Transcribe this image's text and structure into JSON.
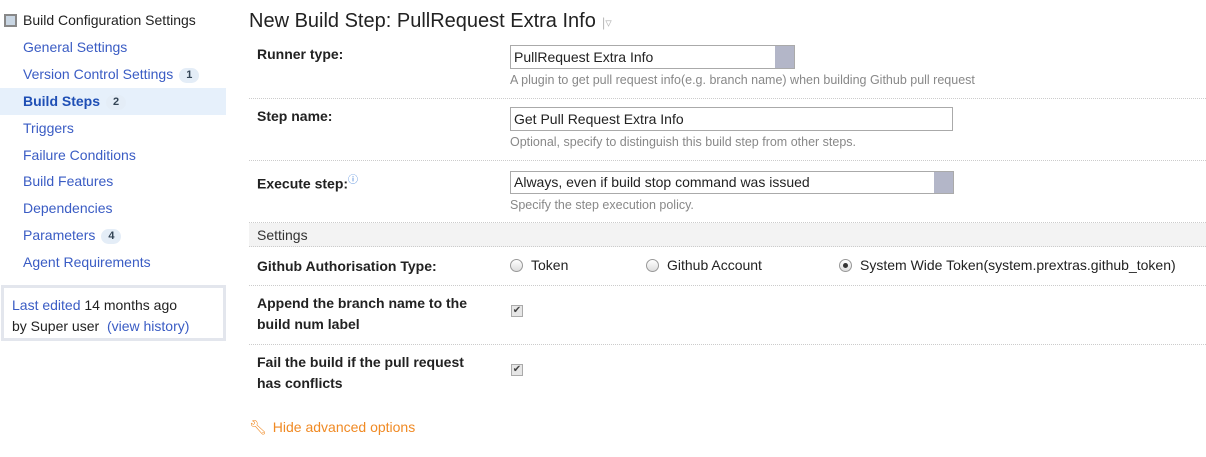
{
  "sidebar": {
    "header": "Build Configuration Settings",
    "items": [
      {
        "label": "General Settings"
      },
      {
        "label": "Version Control Settings",
        "badge": "1"
      },
      {
        "label": "Build Steps",
        "badge": "2"
      },
      {
        "label": "Triggers"
      },
      {
        "label": "Failure Conditions"
      },
      {
        "label": "Build Features"
      },
      {
        "label": "Dependencies"
      },
      {
        "label": "Parameters",
        "badge": "4"
      },
      {
        "label": "Agent Requirements"
      }
    ],
    "info": {
      "last_edited": "Last edited",
      "ago": "14 months ago",
      "by": "by Super user",
      "view_history": "(view history)"
    }
  },
  "page": {
    "title": "New Build Step: PullRequest Extra Info"
  },
  "form": {
    "runner_type": {
      "label": "Runner type:",
      "value": "PullRequest Extra Info",
      "hint": "A plugin to get pull request info(e.g. branch name) when building Github pull request"
    },
    "step_name": {
      "label": "Step name:",
      "value": "Get Pull Request Extra Info",
      "hint": "Optional, specify to distinguish this build step from other steps."
    },
    "execute_step": {
      "label": "Execute step:",
      "value": "Always, even if build stop command was issued",
      "hint": "Specify the step execution policy."
    },
    "settings_header": "Settings",
    "auth": {
      "label": "Github Authorisation Type:",
      "options": [
        "Token",
        "Github Account",
        "System Wide Token(system.prextras.github_token)"
      ],
      "selected": "System Wide Token(system.prextras.github_token)"
    },
    "append": {
      "label1": "Append the branch name to the",
      "label2": "build num label",
      "checked": true
    },
    "fail": {
      "label1": "Fail the build if the pull request",
      "label2": "has conflicts",
      "checked": true
    },
    "advanced": "Hide advanced options"
  }
}
